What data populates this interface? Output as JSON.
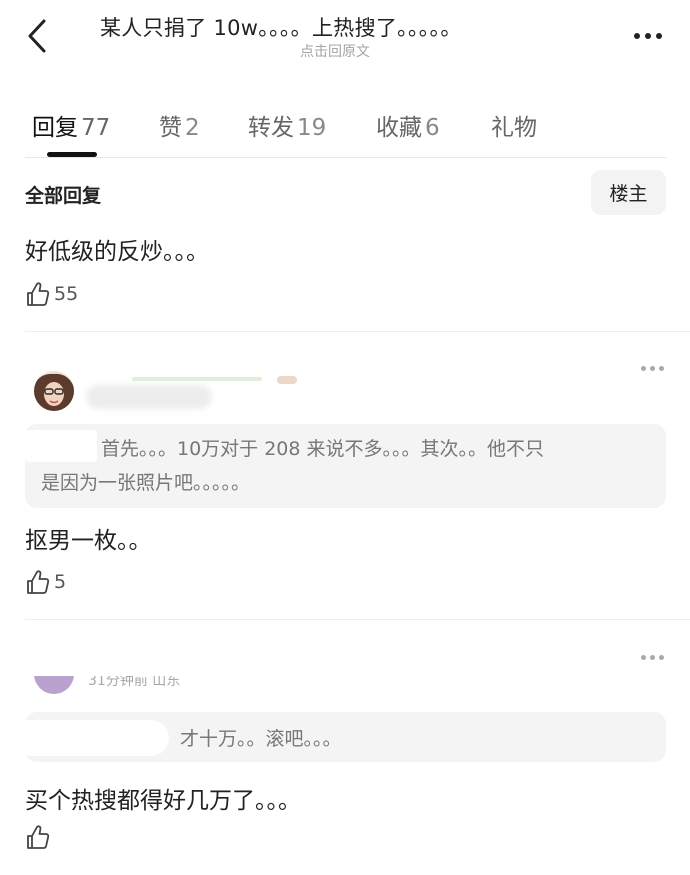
{
  "header": {
    "back_icon": "chevron-left-icon",
    "title": "某人只捐了 10w。。。。上热搜了。。。。。",
    "subtitle": "点击回原文",
    "more_icon": "more-horizontal-icon"
  },
  "tabs": [
    {
      "label": "回复",
      "count": "77",
      "active": true
    },
    {
      "label": "赞",
      "count": "2",
      "active": false
    },
    {
      "label": "转发",
      "count": "19",
      "active": false
    },
    {
      "label": "收藏",
      "count": "6",
      "active": false
    },
    {
      "label": "礼物",
      "count": "",
      "active": false
    }
  ],
  "section": {
    "title": "全部回复",
    "op_button": "楼主"
  },
  "replies": [
    {
      "text": "好低级的反炒。。。",
      "likes": "55",
      "like_icon": "thumbs-up-icon"
    },
    {
      "quote": [
        "首先。。。10万对于 208 来说不多。。。其次。。他不只",
        "是因为一张照片吧。。。。。"
      ],
      "text": "抠男一枚。。",
      "likes": "5",
      "like_icon": "thumbs-up-icon"
    },
    {
      "meta": "31分钟前 山东",
      "quote": [
        "才十万。。滚吧。。。"
      ],
      "text": "买个热搜都得好几万了。。。",
      "likes": "",
      "like_icon": "thumbs-up-icon"
    }
  ]
}
